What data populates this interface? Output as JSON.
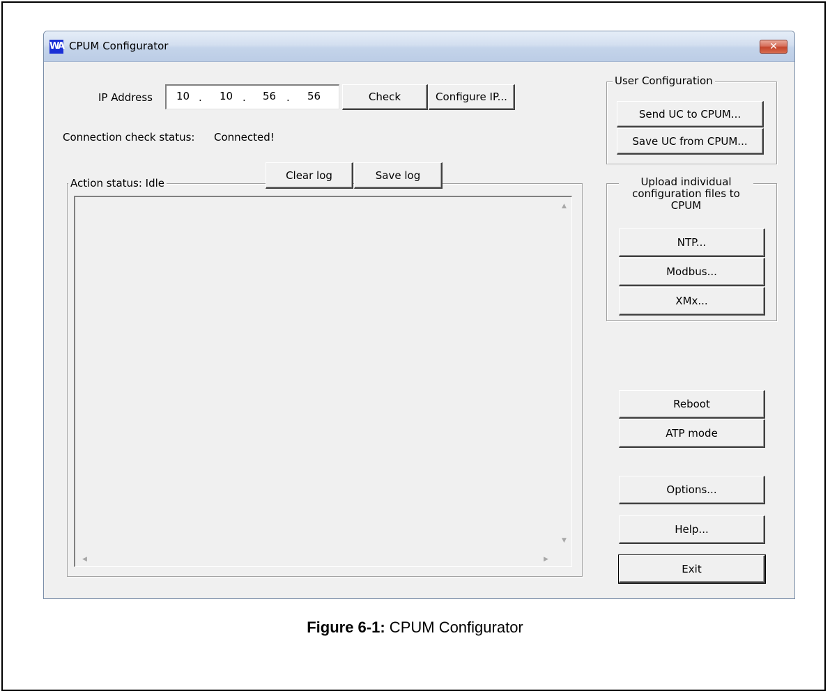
{
  "window": {
    "title": "CPUM Configurator",
    "app_icon": "WA",
    "close_glyph": "✕"
  },
  "ip": {
    "label": "IP Address",
    "octets": [
      "10",
      "10",
      "56",
      "56"
    ],
    "separator": ".",
    "check_label": "Check",
    "configure_label": "Configure IP..."
  },
  "connection": {
    "label": "Connection check status:",
    "value": "Connected!"
  },
  "log": {
    "action_label": "Action status:",
    "action_value": "Idle",
    "clear_label": "Clear log",
    "save_label": "Save log",
    "scroll_up": "▲",
    "scroll_down": "▼",
    "scroll_left": "◀",
    "scroll_right": "▶"
  },
  "user_config": {
    "title": "User Configuration",
    "send_label": "Send UC to CPUM...",
    "save_label": "Save UC from CPUM..."
  },
  "upload": {
    "title_lines": [
      "Upload individual",
      "configuration files to",
      "CPUM"
    ],
    "buttons": [
      "NTP...",
      "Modbus...",
      "XMx..."
    ]
  },
  "actions": {
    "reboot": "Reboot",
    "atp": "ATP mode",
    "options": "Options...",
    "help": "Help...",
    "exit": "Exit"
  },
  "caption": {
    "prefix": "Figure 6-1:",
    "text": " CPUM Configurator"
  }
}
